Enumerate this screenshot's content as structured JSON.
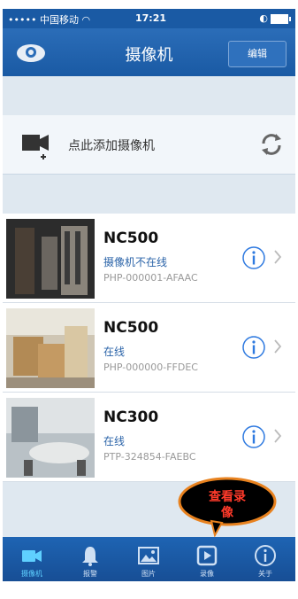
{
  "status_bar": {
    "carrier": "••••• 中国移动",
    "time": "17:21"
  },
  "nav": {
    "title": "摄像机",
    "edit_label": "编辑"
  },
  "add_camera": {
    "label": "点此添加摄像机"
  },
  "cameras": [
    {
      "name": "NC500",
      "status": "摄像机不在线",
      "id": "PHP-000001-AFAAC"
    },
    {
      "name": "NC500",
      "status": "在线",
      "id": "PHP-000000-FFDEC"
    },
    {
      "name": "NC300",
      "status": "在线",
      "id": "PTP-324854-FAEBC"
    }
  ],
  "callout": {
    "line1": "查看录",
    "line2": "像"
  },
  "tabs": [
    {
      "label": "摄像机",
      "icon": "camera-icon",
      "active": true
    },
    {
      "label": "报警",
      "icon": "bell-icon",
      "active": false
    },
    {
      "label": "图片",
      "icon": "picture-icon",
      "active": false
    },
    {
      "label": "录像",
      "icon": "play-icon",
      "active": false
    },
    {
      "label": "关于",
      "icon": "info-icon",
      "active": false
    }
  ],
  "colors": {
    "nav_blue": "#1a5aa4",
    "status_blue": "#2a63a8",
    "active_tab": "#5fd0ff",
    "callout_border": "#e8821f",
    "callout_text": "#ff3a2a"
  }
}
